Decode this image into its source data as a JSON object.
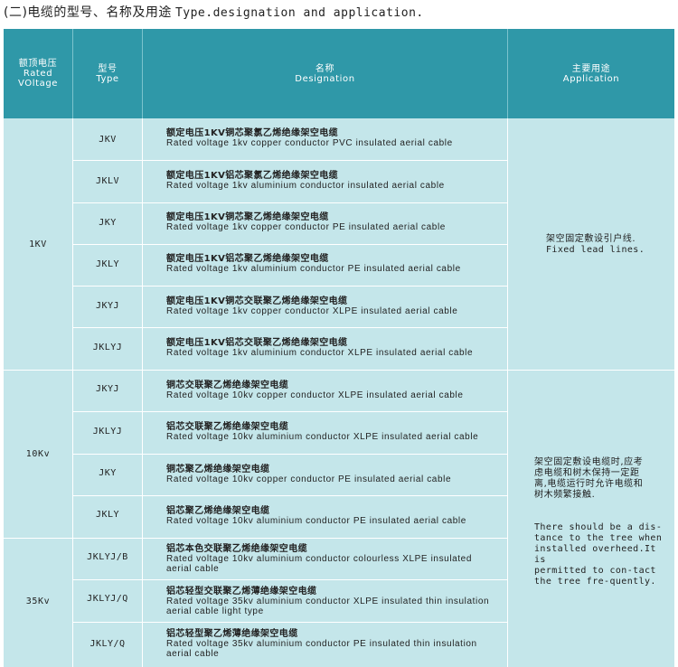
{
  "title": {
    "zh": "(二)电缆的型号、名称及用途",
    "en": "Type.designation  and application."
  },
  "header": {
    "voltage": [
      "额顶电压",
      "Rated",
      "VOltage"
    ],
    "type": [
      "型号",
      "Type"
    ],
    "designation": [
      "名称",
      "Designation"
    ],
    "application": [
      "主要用途",
      "Application"
    ]
  },
  "groups": [
    {
      "voltage": "1KV"
    },
    {
      "voltage": "10Kv"
    },
    {
      "voltage": "35Kv"
    }
  ],
  "rows": [
    {
      "type": "JKV",
      "zh": "额定电压1KV铜芯聚氯乙烯绝缘架空电缆",
      "en": "Rated voltage 1kv copper conductor PVC insulated aerial cable"
    },
    {
      "type": "JKLV",
      "zh": "额定电压1KV铝芯聚氯乙烯绝缘架空电缆",
      "en": "Rated voltage 1kv aluminium conductor  insulated aerial cable"
    },
    {
      "type": "JKY",
      "zh": "额定电压1KV铜芯聚乙烯绝缘架空电缆",
      "en": "Rated voltage 1kv copper conductor PE insulated aerial cable"
    },
    {
      "type": "JKLY",
      "zh": "额定电压1KV铝芯聚乙烯绝缘架空电缆",
      "en": "Rated voltage 1kv aluminium  conductor PE  insulated  aerial  cable"
    },
    {
      "type": "JKYJ",
      "zh": "额定电压1KV铜芯交联聚乙烯绝缘架空电缆",
      "en": "Rated voltage 1kv copper conductor XLPE insulated aerial cable"
    },
    {
      "type": "JKLYJ",
      "zh": "额定电压1KV铝芯交联聚乙烯绝缘架空电缆",
      "en": "Rated voltage 1kv aluminium  conductor XLPE insulated aerial cable"
    },
    {
      "type": "JKYJ",
      "zh": "铜芯交联聚乙烯绝缘架空电缆",
      "en": "Rated voltage 10kv copper  conductor XLPE insulated aerial cable"
    },
    {
      "type": "JKLYJ",
      "zh": "铝芯交联聚乙烯绝缘架空电缆",
      "en": "Rated voltage 10kv aluminium  conductor XLPE insulated aerial cable"
    },
    {
      "type": "JKY",
      "zh": "铜芯聚乙烯绝缘架空电缆",
      "en": "Rated voltage 10kv copper conductor PE insulated aerial cable"
    },
    {
      "type": "JKLY",
      "zh": "铝芯聚乙烯绝缘架空电缆",
      "en": "Rated voltage 10kv aluminium  conductor PE insulated aerial cable"
    },
    {
      "type": "JKLYJ/B",
      "zh": "铝芯本色交联聚乙烯绝缘架空电缆",
      "en": "Rated voltage 10kv aluminium  conductor  colourless XLPE insulated",
      "en2": "aerial cable"
    },
    {
      "type": "JKLYJ/Q",
      "zh": "铝芯轻型交联聚乙烯薄绝缘架空电缆",
      "en": "Rated voltage 35kv aluminium  conductor XLPE insulated thin insulation",
      "en2": "aerial cable light type"
    },
    {
      "type": "JKLY/Q",
      "zh": "铝芯轻型聚乙烯薄绝缘架空电缆",
      "en": "Rated voltage 35kv aluminium  conductor PE insulated thin insulation",
      "en2": "aerial cable"
    }
  ],
  "applications": [
    {
      "zh": [
        "架空固定敷设引户线."
      ],
      "en": [
        "Fixed lead lines."
      ]
    },
    {
      "zh": [
        "架空固定敷设电缆时,应考",
        "虑电缆和树木保持一定距",
        "离,电缆运行时允许电缆和",
        "树木频繁接触."
      ],
      "en": [
        "There should be a dis-",
        "tance to the tree when",
        "installed overheed.It is",
        "permitted to con-tact",
        "the tree fre-quently."
      ]
    }
  ]
}
